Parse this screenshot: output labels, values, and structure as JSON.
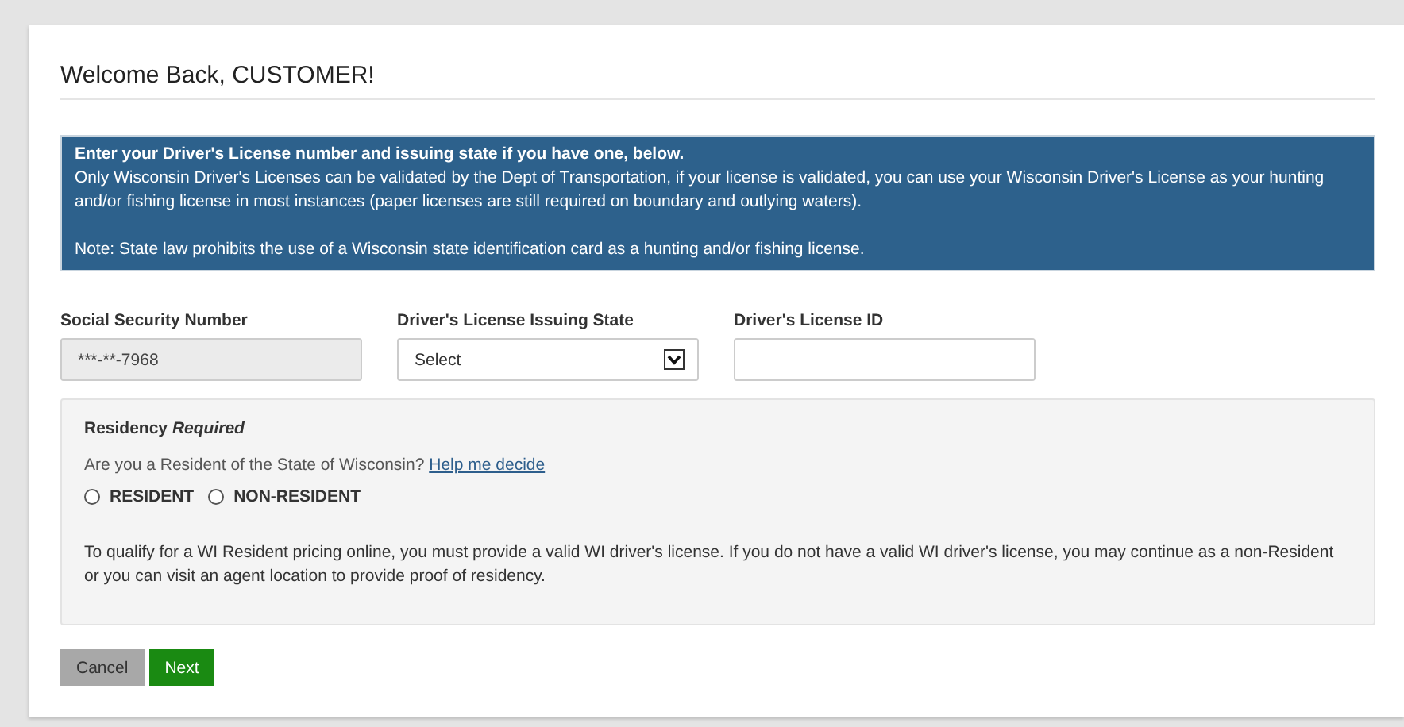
{
  "heading": "Welcome Back, CUSTOMER!",
  "notice": {
    "title": "Enter your Driver's License number and issuing state if you have one, below.",
    "body": "Only Wisconsin Driver's Licenses can be validated by the Dept of Transportation, if your license is validated, you can use your Wisconsin Driver's License as your hunting and/or fishing license in most instances (paper licenses are still required on boundary and outlying waters).",
    "note": "Note: State law prohibits the use of a Wisconsin state identification card as a hunting and/or fishing license."
  },
  "fields": [
    {
      "kind": "readonly",
      "label": "Social Security Number",
      "value": "***-**-7968"
    },
    {
      "kind": "select",
      "label": "Driver's License Issuing State",
      "value": "Select"
    },
    {
      "kind": "text",
      "label": "Driver's License ID"
    }
  ],
  "residency": {
    "title": "Residency",
    "title_note": "Required",
    "question": "Are you a Resident of the State of Wisconsin?",
    "link": "Help me decide",
    "options": [
      {
        "label": "RESIDENT",
        "selected": false
      },
      {
        "label": "NON-RESIDENT",
        "selected": false
      }
    ],
    "info": "To qualify for a WI Resident pricing online, you must provide a valid WI driver's license. If you do not have a valid WI driver's license, you may continue as a non-Resident or you can visit an agent location to provide proof of residency."
  },
  "buttons": [
    {
      "kind": "secondary",
      "label": "Cancel"
    },
    {
      "kind": "primary",
      "label": "Next"
    }
  ]
}
